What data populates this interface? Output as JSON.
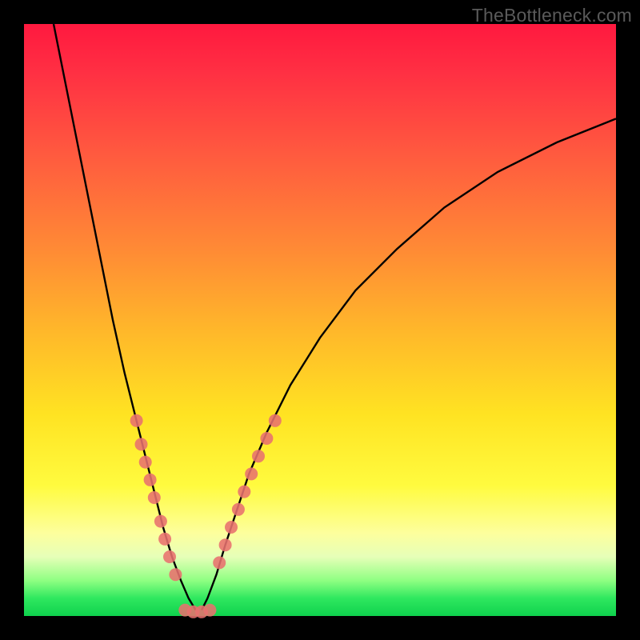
{
  "watermark": "TheBottleneck.com",
  "chart_data": {
    "type": "line",
    "title": "",
    "xlabel": "",
    "ylabel": "",
    "x_range": [
      0,
      100
    ],
    "y_range": [
      0,
      100
    ],
    "series": [
      {
        "name": "left-branch",
        "x": [
          5,
          7,
          9,
          11,
          13,
          15,
          17,
          19,
          20.5,
          22,
          23.5,
          25,
          26.5,
          27.8,
          29
        ],
        "y": [
          100,
          90,
          80,
          70,
          60,
          50,
          41,
          33,
          27,
          21,
          15,
          10,
          6,
          3,
          1
        ]
      },
      {
        "name": "right-branch",
        "x": [
          30,
          31,
          32.5,
          34,
          36,
          38,
          41,
          45,
          50,
          56,
          63,
          71,
          80,
          90,
          100
        ],
        "y": [
          1,
          3,
          7,
          12,
          18,
          24,
          31,
          39,
          47,
          55,
          62,
          69,
          75,
          80,
          84
        ]
      }
    ],
    "valley_points": {
      "name": "valley-dots",
      "x": [
        27.2,
        28.6,
        30.0,
        31.4
      ],
      "y": [
        1.0,
        0.7,
        0.7,
        1.0
      ]
    },
    "left_dots": {
      "name": "left-branch-dots",
      "x": [
        19.0,
        19.8,
        20.5,
        21.3,
        22.0,
        23.1,
        23.8,
        24.6,
        25.6
      ],
      "y": [
        33,
        29,
        26,
        23,
        20,
        16,
        13,
        10,
        7
      ]
    },
    "right_dots": {
      "name": "right-branch-dots",
      "x": [
        33.0,
        34.0,
        35.0,
        36.2,
        37.2,
        38.4,
        39.6,
        41.0,
        42.4
      ],
      "y": [
        9,
        12,
        15,
        18,
        21,
        24,
        27,
        30,
        33
      ]
    }
  }
}
